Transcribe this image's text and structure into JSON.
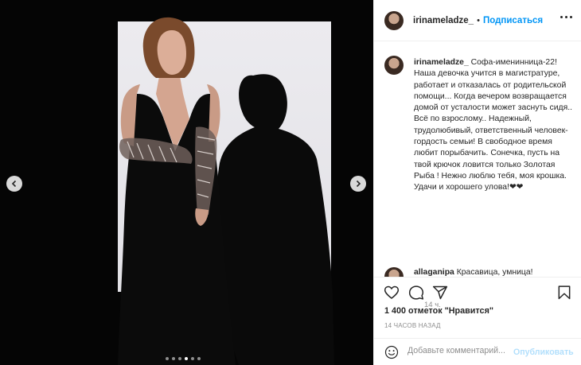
{
  "header": {
    "username": "irinameladze_",
    "separator": "•",
    "follow_label": "Подписаться"
  },
  "caption": {
    "username": "irinameladze_",
    "text": "Софа-именинница-22! Наша девочка учится в магистратуре, работает и отказалась от родительской помощи... Когда вечером возвращается домой от усталости может заснуть сидя.. Всё по взрослому.. Надежный, трудолюбивый, ответственный человек- гордость семьи! В свободное время любит порыбачить. Сонечка, пусть на твой крючок ловится только Золотая Рыба ! Нежно люблю тебя, моя крошка. Удачи и хорошего улова!❤❤",
    "time": "14 ч."
  },
  "comment": {
    "username": "allaganipa",
    "text": "Красавица, умница!"
  },
  "stats": {
    "likes": "1 400 отметок \"Нравится\"",
    "time_ago": "14 ЧАСОВ НАЗАД"
  },
  "comment_input": {
    "placeholder": "Добавьте комментарий...",
    "publish_label": "Опубликовать"
  },
  "carousel": {
    "slide_count": 6,
    "active_index": 3
  },
  "colors": {
    "link_blue": "#0095f6",
    "publish_disabled": "#b2dffc",
    "muted_text": "#8e8e8e",
    "photo_bg": "#050505"
  },
  "icons": [
    "heart-icon",
    "comment-icon",
    "share-icon",
    "bookmark-icon",
    "emoji-icon",
    "more-icon",
    "chevron-left-icon",
    "chevron-right-icon"
  ]
}
